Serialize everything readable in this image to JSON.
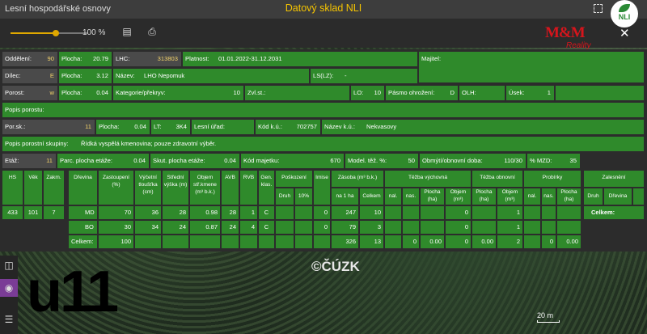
{
  "topbar": {
    "left_title": "Lesní hospodářské osnovy",
    "center_title": "Datový sklad NLI",
    "badge": "NLI"
  },
  "toolbar": {
    "zoom": "100 %",
    "logo": "M&M",
    "logo_sub": "Reality"
  },
  "fields": {
    "oddeleni": {
      "label": "Oddělení:",
      "value": "90"
    },
    "plocha1": {
      "label": "Plocha:",
      "value": "20.79"
    },
    "lhc": {
      "label": "LHC:",
      "value": "313803"
    },
    "platnost": {
      "label": "Platnost:",
      "value": "01.01.2022-31.12.2031"
    },
    "majitel": {
      "label": "Majitel:",
      "value": ""
    },
    "dilec": {
      "label": "Dílec:",
      "value": "E"
    },
    "plocha2": {
      "label": "Plocha:",
      "value": "3.12"
    },
    "nazev": {
      "label": "Název:",
      "value": "LHO Nepomuk"
    },
    "ls": {
      "label": "LS(LZ):",
      "value": "-"
    },
    "porost": {
      "label": "Porost:",
      "value": "w"
    },
    "plocha3": {
      "label": "Plocha:",
      "value": "0.04"
    },
    "kategorie": {
      "label": "Kategorie/překryv:",
      "value": "10"
    },
    "zvlst": {
      "label": "Zvl.st.:",
      "value": ""
    },
    "lo": {
      "label": "LO:",
      "value": "10"
    },
    "pasmo": {
      "label": "Pásmo ohrožení:",
      "value": "D"
    },
    "olh": {
      "label": "OLH:",
      "value": ""
    },
    "usek": {
      "label": "Úsek:",
      "value": "1"
    },
    "popis_porostu": {
      "label": "Popis porostu:",
      "value": ""
    },
    "porsk": {
      "label": "Por.sk.:",
      "value": "11"
    },
    "plocha4": {
      "label": "Plocha:",
      "value": "0.04"
    },
    "lt": {
      "label": "LT:",
      "value": "3K4"
    },
    "lesni_urad": {
      "label": "Lesní úřad:",
      "value": ""
    },
    "kod_ku": {
      "label": "Kód k.ú.:",
      "value": "702757"
    },
    "nazev_ku": {
      "label": "Název k.ú.:",
      "value": "Nekvasovy"
    },
    "popis_skupiny": {
      "label": "Popis porostní skupiny:",
      "value": "Řídká vyspělá kmenovina; pouze zdravotní výběr."
    },
    "etaz": {
      "label": "Etáž:",
      "value": "11"
    },
    "parc": {
      "label": "Parc. plocha etáže:",
      "value": "0.04"
    },
    "skut": {
      "label": "Skut. plocha etáže:",
      "value": "0.04"
    },
    "kod_majetku": {
      "label": "Kód majetku:",
      "value": "670"
    },
    "model": {
      "label": "Model. těž. %:",
      "value": "50"
    },
    "obmyti": {
      "label": "Obmýtí/obnovní doba:",
      "value": "110/30"
    },
    "mzd": {
      "label": "% MZD:",
      "value": "35"
    }
  },
  "table": {
    "h_hs": "HS",
    "h_vek": "Věk",
    "h_zakm": "Zakm.",
    "h_dreviny": "Dřevina",
    "h_zast": "Zastoupení (%)",
    "h_tloust": "Výčetní tloušťka (cm)",
    "h_vyska": "Střední výška (m)",
    "h_objem": "Objem stř.kmene (m³ b.k.)",
    "h_avb": "AVB",
    "h_rvb": "RVB",
    "h_gen": "Gen. klas.",
    "h_posk": "Poškození",
    "h_druh": "Druh",
    "h_10": "10%",
    "h_imise": "Imise",
    "h_zasoba": "Zásoba (m³ b.k.)",
    "h_na1ha": "na 1 ha",
    "h_celkem": "Celkem",
    "h_tv": "Těžba výchovná",
    "h_nal": "nal.",
    "h_nas": "nas.",
    "h_plocha": "Plocha (ha)",
    "h_objemm3": "Objem (m³)",
    "h_to": "Těžba obnovní",
    "h_prof": "Probírky",
    "h_zal": "Zalesnění",
    "h_zdruh": "Druh",
    "h_zdrev": "Dřevina",
    "hs": "433",
    "vek": "101",
    "zakm": "7",
    "rows": [
      {
        "dr": "MD",
        "z": "70",
        "t": "36",
        "v": "28",
        "o": "0.98",
        "avb": "28",
        "rvb": "1",
        "g": "C",
        "im": "0",
        "zh": "247",
        "zc": "10",
        "tvo": "0",
        "too": "1"
      },
      {
        "dr": "BO",
        "z": "30",
        "t": "34",
        "v": "24",
        "o": "0.87",
        "avb": "24",
        "rvb": "4",
        "g": "C",
        "im": "0",
        "zh": "79",
        "zc": "3",
        "tvo": "0",
        "too": "1"
      }
    ],
    "total": {
      "label": "Celkem:",
      "z": "100",
      "zh": "326",
      "zc": "13",
      "n1": "0",
      "p1": "0.00",
      "o1": "0",
      "p2": "0.00",
      "o2": "2",
      "n3": "0",
      "p3": "0.00"
    },
    "zal_total": "Celkem:"
  },
  "map": {
    "watermark": "©ČÚZK",
    "label": "u11",
    "scale": "20 m"
  }
}
